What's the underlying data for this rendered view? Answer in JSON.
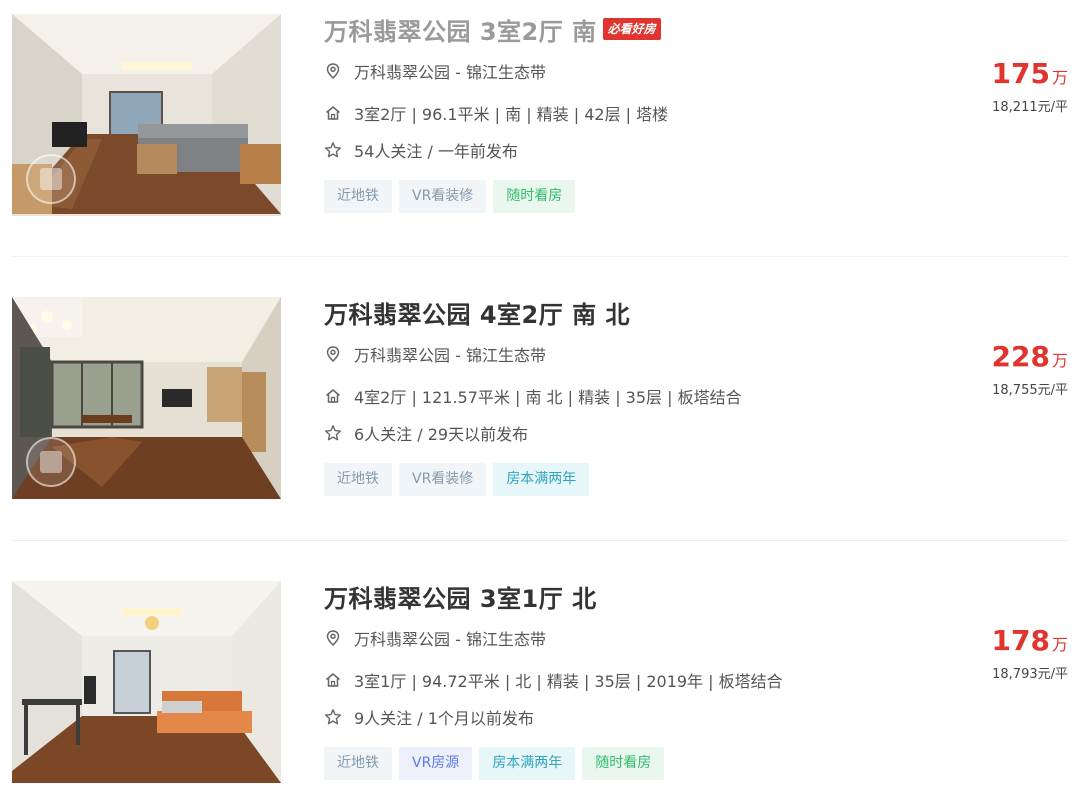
{
  "listings": [
    {
      "title": "万科翡翠公园 3室2厅 南",
      "badge": "必看好房",
      "address": "万科翡翠公园 - 锦江生态带",
      "details": "3室2厅 | 96.1平米 | 南 | 精装 | 42层 | 塔楼",
      "follow": "54人关注 / 一年前发布",
      "tags": [
        "近地铁",
        "VR看装修",
        "随时看房"
      ],
      "price_total": "175",
      "price_unit": "万",
      "price_per": "18,211元/平"
    },
    {
      "title": "万科翡翠公园 4室2厅 南 北",
      "address": "万科翡翠公园 - 锦江生态带",
      "details": "4室2厅 | 121.57平米 | 南 北 | 精装 | 35层 | 板塔结合",
      "follow": "6人关注 / 29天以前发布",
      "tags": [
        "近地铁",
        "VR看装修",
        "房本满两年"
      ],
      "price_total": "228",
      "price_unit": "万",
      "price_per": "18,755元/平"
    },
    {
      "title": "万科翡翠公园 3室1厅 北",
      "address": "万科翡翠公园 - 锦江生态带",
      "details": "3室1厅 | 94.72平米 | 北 | 精装 | 35层 | 2019年 | 板塔结合",
      "follow": "9人关注 / 1个月以前发布",
      "tags": [
        "近地铁",
        "VR房源",
        "房本满两年",
        "随时看房"
      ],
      "price_total": "178",
      "price_unit": "万",
      "price_per": "18,793元/平"
    }
  ],
  "icons": {
    "location": "location-pin-icon",
    "house": "house-icon",
    "follow": "star-icon",
    "vr": "vr-panorama-icon"
  },
  "colors": {
    "price": "#e0342e",
    "badge": "#e0342e",
    "title": "#333333",
    "title_visited": "#9a9a9a"
  }
}
